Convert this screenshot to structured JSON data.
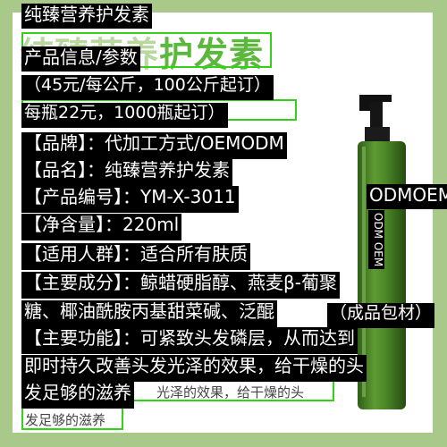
{
  "title": "纯臻营养护发素",
  "bg_title_left": "纯臻营养",
  "bg_title_right": "护发素",
  "heading": "产品信息/参数",
  "price_per_kg": "（45元/每公斤，100公斤起订）",
  "price_per_bottle": "每瓶22元，1000瓶起订）",
  "brand": "【品牌】：代加工方式/OEMODM",
  "product_name": "【品名】：纯臻营养护发素",
  "product_code": "【产品编号】：YM-X-3011",
  "net_content": "【净含量】：220ml",
  "target_users": "【适用人群】：适合所有肤质",
  "ingredients_line1": "【主要成分】：鲸蜡硬脂醇、燕麦β-葡聚",
  "ingredients_line2": "糖、椰油酰胺丙基甜菜碱、泛醌",
  "packaging_note": "（成品包材）",
  "functions_line1": "【主要功能】：可紧致头发磷层，从而达到",
  "functions_line2": "即时持久改善头发光泽的效果，给干燥的头",
  "functions_line3": "发足够的滋养",
  "echo_text": "光泽的效果，给干燥的头",
  "echo_text2": "发足够的滋养",
  "bottle_label_horizontal": "ODMOEM",
  "bottle_label_vertical": "ODM OEM",
  "colors": {
    "page_background": "#a9c98a",
    "highlight_box": "#34d11a",
    "bottle_green": "#4f8a2b",
    "bottle_pump": "#111111"
  }
}
